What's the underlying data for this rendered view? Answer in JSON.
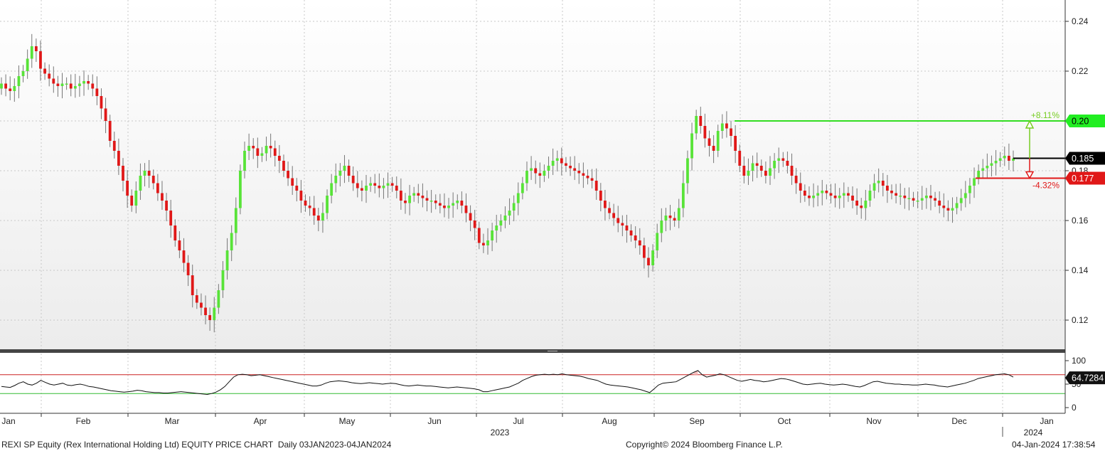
{
  "chart_data": {
    "type": "candlestick",
    "price_axis": {
      "ticks": [
        0.12,
        0.14,
        0.16,
        0.18,
        0.2,
        0.22,
        0.24
      ],
      "range": [
        0.1,
        0.26
      ]
    },
    "rsi_axis": {
      "ticks": [
        0,
        50,
        100
      ],
      "range": [
        -8,
        108
      ],
      "overbought": 70,
      "oversold": 30
    },
    "months": [
      "Jan",
      "Feb",
      "Mar",
      "Apr",
      "May",
      "Jun",
      "Jul",
      "Aug",
      "Sep",
      "Oct",
      "Nov",
      "Dec",
      "Jan"
    ],
    "year_labels": [
      "2023",
      "2024"
    ],
    "price_labels": {
      "last": "0.185",
      "upper": "0.20",
      "lower": "0.177"
    },
    "rsi_label": "64.7284",
    "annotations": {
      "up_pct": "+8.11%",
      "down_pct": "-4.32%"
    },
    "levels": {
      "upper": 0.2,
      "lower": 0.177,
      "last": 0.185
    },
    "closes": [
      0.215,
      0.213,
      0.212,
      0.214,
      0.218,
      0.22,
      0.225,
      0.23,
      0.228,
      0.221,
      0.219,
      0.217,
      0.215,
      0.214,
      0.215,
      0.215,
      0.213,
      0.214,
      0.215,
      0.216,
      0.215,
      0.213,
      0.21,
      0.205,
      0.2,
      0.192,
      0.188,
      0.182,
      0.176,
      0.17,
      0.166,
      0.172,
      0.178,
      0.18,
      0.178,
      0.175,
      0.171,
      0.168,
      0.164,
      0.158,
      0.152,
      0.148,
      0.143,
      0.138,
      0.13,
      0.127,
      0.125,
      0.122,
      0.12,
      0.125,
      0.132,
      0.14,
      0.148,
      0.155,
      0.165,
      0.18,
      0.188,
      0.19,
      0.189,
      0.186,
      0.187,
      0.19,
      0.189,
      0.186,
      0.184,
      0.18,
      0.177,
      0.174,
      0.172,
      0.168,
      0.166,
      0.165,
      0.162,
      0.16,
      0.163,
      0.17,
      0.175,
      0.178,
      0.18,
      0.182,
      0.178,
      0.175,
      0.173,
      0.172,
      0.174,
      0.175,
      0.174,
      0.173,
      0.174,
      0.175,
      0.174,
      0.172,
      0.168,
      0.167,
      0.17,
      0.171,
      0.17,
      0.169,
      0.168,
      0.168,
      0.167,
      0.166,
      0.165,
      0.166,
      0.167,
      0.168,
      0.166,
      0.163,
      0.16,
      0.157,
      0.151,
      0.15,
      0.152,
      0.156,
      0.158,
      0.16,
      0.162,
      0.164,
      0.167,
      0.171,
      0.175,
      0.18,
      0.181,
      0.179,
      0.178,
      0.18,
      0.182,
      0.184,
      0.185,
      0.183,
      0.182,
      0.181,
      0.18,
      0.179,
      0.178,
      0.177,
      0.176,
      0.172,
      0.168,
      0.165,
      0.163,
      0.161,
      0.159,
      0.158,
      0.156,
      0.154,
      0.152,
      0.15,
      0.145,
      0.142,
      0.148,
      0.155,
      0.16,
      0.162,
      0.161,
      0.16,
      0.165,
      0.175,
      0.185,
      0.195,
      0.202,
      0.198,
      0.193,
      0.19,
      0.188,
      0.196,
      0.199,
      0.197,
      0.194,
      0.188,
      0.182,
      0.178,
      0.18,
      0.183,
      0.182,
      0.18,
      0.178,
      0.181,
      0.184,
      0.185,
      0.184,
      0.182,
      0.178,
      0.175,
      0.172,
      0.17,
      0.169,
      0.17,
      0.171,
      0.172,
      0.171,
      0.17,
      0.169,
      0.17,
      0.171,
      0.17,
      0.168,
      0.166,
      0.165,
      0.168,
      0.172,
      0.175,
      0.176,
      0.174,
      0.172,
      0.171,
      0.17,
      0.17,
      0.169,
      0.169,
      0.168,
      0.168,
      0.169,
      0.17,
      0.169,
      0.168,
      0.166,
      0.165,
      0.164,
      0.165,
      0.167,
      0.169,
      0.171,
      0.174,
      0.177,
      0.18,
      0.181,
      0.182,
      0.183,
      0.184,
      0.185,
      0.186,
      0.184,
      0.185
    ],
    "rsi": [
      45,
      44,
      43,
      47,
      52,
      55,
      50,
      48,
      52,
      58,
      54,
      50,
      48,
      50,
      52,
      48,
      47,
      49,
      50,
      48,
      45,
      44,
      42,
      40,
      38,
      36,
      35,
      34,
      33,
      34,
      35,
      37,
      36,
      34,
      33,
      32,
      32,
      31,
      31,
      32,
      33,
      34,
      33,
      32,
      31,
      30,
      29,
      28,
      30,
      33,
      38,
      45,
      55,
      65,
      70,
      71,
      70,
      68,
      69,
      70,
      68,
      66,
      64,
      62,
      60,
      58,
      56,
      54,
      52,
      50,
      48,
      46,
      46,
      48,
      52,
      55,
      56,
      57,
      56,
      55,
      53,
      52,
      51,
      52,
      53,
      52,
      51,
      50,
      51,
      52,
      51,
      49,
      47,
      46,
      47,
      48,
      47,
      46,
      46,
      45,
      44,
      43,
      42,
      43,
      44,
      43,
      42,
      41,
      40,
      38,
      34,
      34,
      36,
      38,
      40,
      42,
      44,
      48,
      52,
      58,
      62,
      66,
      69,
      70,
      71,
      70,
      71,
      70,
      72,
      70,
      69,
      68,
      67,
      65,
      62,
      60,
      58,
      54,
      50,
      48,
      47,
      46,
      45,
      44,
      42,
      40,
      38,
      35,
      32,
      40,
      48,
      52,
      53,
      54,
      55,
      60,
      65,
      70,
      75,
      79,
      70,
      65,
      67,
      69,
      72,
      70,
      66,
      62,
      58,
      56,
      58,
      60,
      58,
      57,
      55,
      56,
      58,
      60,
      62,
      61,
      59,
      56,
      53,
      50,
      49,
      50,
      51,
      52,
      50,
      49,
      48,
      49,
      50,
      49,
      47,
      45,
      44,
      47,
      51,
      55,
      56,
      54,
      52,
      51,
      50,
      50,
      49,
      49,
      48,
      48,
      49,
      50,
      49,
      48,
      46,
      45,
      44,
      46,
      48,
      50,
      52,
      55,
      58,
      62,
      64,
      66,
      68,
      70,
      71,
      72,
      70,
      65
    ]
  }
}
